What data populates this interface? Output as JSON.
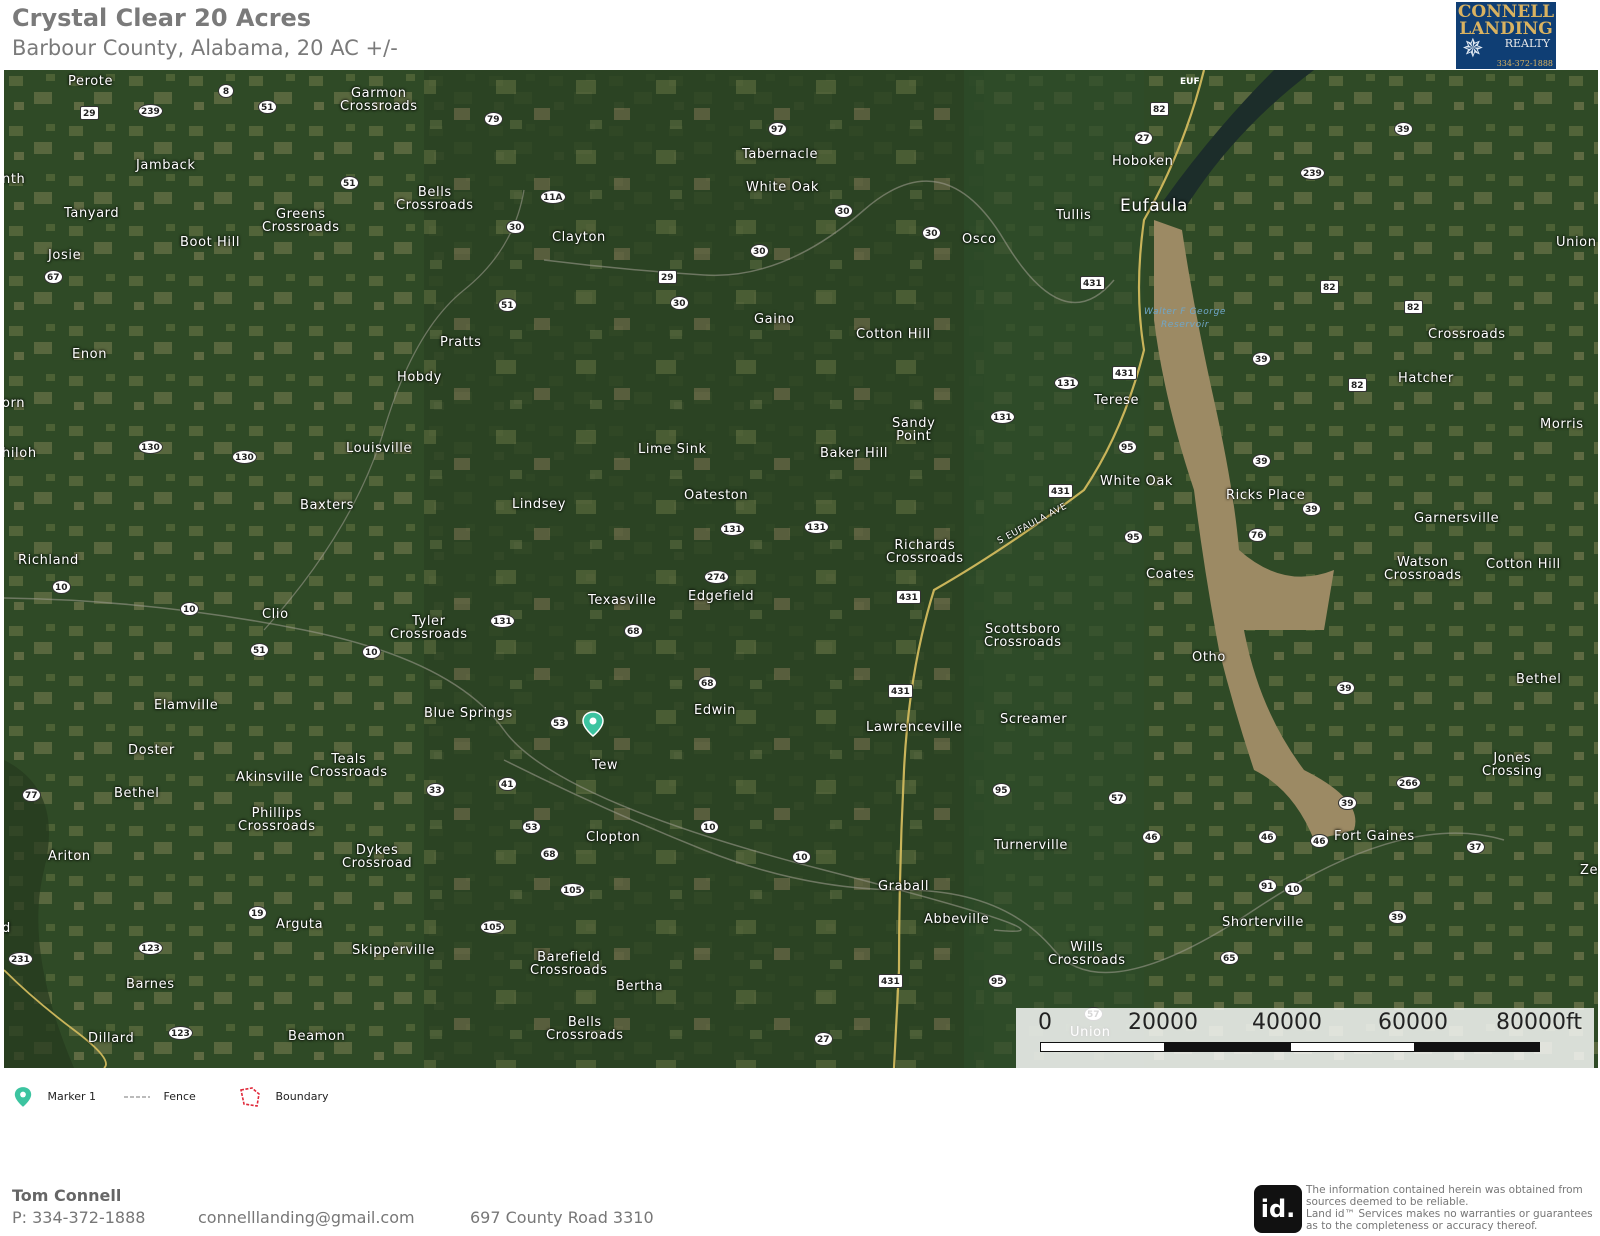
{
  "header": {
    "title": "Crystal Clear 20 Acres",
    "subtitle": "Barbour County, Alabama, 20 AC +/-"
  },
  "logo": {
    "line1": "CONNELL",
    "line2": "LANDING",
    "line3": "REALTY",
    "phone": "334-372-1888"
  },
  "map": {
    "places": [
      {
        "name": "Perote",
        "id": "perote"
      },
      {
        "name": "Garmon\nCrossroads",
        "id": "garmon"
      },
      {
        "name": "Jamback",
        "id": "jamback"
      },
      {
        "name": "Tabernacle",
        "id": "tabernacle"
      },
      {
        "name": "White Oak",
        "id": "white-oak-n"
      },
      {
        "name": "Hoboken",
        "id": "hoboken"
      },
      {
        "name": "Eufaula",
        "id": "eufaula"
      },
      {
        "name": "Tullis",
        "id": "tullis"
      },
      {
        "name": "Tanyard",
        "id": "tanyard"
      },
      {
        "name": "Greens\nCrossroads",
        "id": "greens"
      },
      {
        "name": "Bells\nCrossroads",
        "id": "bells-n"
      },
      {
        "name": "Clayton",
        "id": "clayton"
      },
      {
        "name": "Osco",
        "id": "osco"
      },
      {
        "name": "Union",
        "id": "union-e"
      },
      {
        "name": "Boot Hill",
        "id": "boot-hill"
      },
      {
        "name": "Josie",
        "id": "josie"
      },
      {
        "name": "Gaino",
        "id": "gaino"
      },
      {
        "name": "Cotton Hill",
        "id": "cotton-hill-n"
      },
      {
        "name": "Crossroads",
        "id": "crossroads-e"
      },
      {
        "name": "Enon",
        "id": "enon"
      },
      {
        "name": "Pratts",
        "id": "pratts"
      },
      {
        "name": "Hobdy",
        "id": "hobdy"
      },
      {
        "name": "Hatcher",
        "id": "hatcher"
      },
      {
        "name": "Terese",
        "id": "terese"
      },
      {
        "name": "Morris",
        "id": "morris"
      },
      {
        "name": "Sandy\nPoint",
        "id": "sandy-point"
      },
      {
        "name": "Louisville",
        "id": "louisville"
      },
      {
        "name": "Lime Sink",
        "id": "lime-sink"
      },
      {
        "name": "Baker Hill",
        "id": "baker-hill"
      },
      {
        "name": "White Oak",
        "id": "white-oak-s"
      },
      {
        "name": "Ricks Place",
        "id": "ricks-place"
      },
      {
        "name": "Oateston",
        "id": "oateston"
      },
      {
        "name": "Baxters",
        "id": "baxters"
      },
      {
        "name": "Lindsey",
        "id": "lindsey"
      },
      {
        "name": "Garnersville",
        "id": "garnersville"
      },
      {
        "name": "Richards\nCrossroads",
        "id": "richards"
      },
      {
        "name": "Richland",
        "id": "richland"
      },
      {
        "name": "Watson\nCrossroads",
        "id": "watson"
      },
      {
        "name": "Cotton Hill",
        "id": "cotton-hill-e"
      },
      {
        "name": "Coates",
        "id": "coates"
      },
      {
        "name": "Edgefield",
        "id": "edgefield"
      },
      {
        "name": "Texasville",
        "id": "texasville"
      },
      {
        "name": "Clio",
        "id": "clio"
      },
      {
        "name": "Tyler\nCrossroads",
        "id": "tyler"
      },
      {
        "name": "Scottsboro\nCrossroads",
        "id": "scottsboro"
      },
      {
        "name": "Otho",
        "id": "otho"
      },
      {
        "name": "Bethel",
        "id": "bethel-e"
      },
      {
        "name": "Elamville",
        "id": "elamville"
      },
      {
        "name": "Edwin",
        "id": "edwin"
      },
      {
        "name": "Blue Springs",
        "id": "blue-springs"
      },
      {
        "name": "Screamer",
        "id": "screamer"
      },
      {
        "name": "Lawrenceville",
        "id": "lawrenceville"
      },
      {
        "name": "Doster",
        "id": "doster"
      },
      {
        "name": "Teals\nCrossroads",
        "id": "teals"
      },
      {
        "name": "Tew",
        "id": "tew"
      },
      {
        "name": "Jones\nCrossing",
        "id": "jones"
      },
      {
        "name": "Akinsville",
        "id": "akinsville"
      },
      {
        "name": "Bethel",
        "id": "bethel-w"
      },
      {
        "name": "Phillips\nCrossroads",
        "id": "phillips"
      },
      {
        "name": "Clopton",
        "id": "clopton"
      },
      {
        "name": "Fort Gaines",
        "id": "fort-gaines"
      },
      {
        "name": "Turnerville",
        "id": "turnerville"
      },
      {
        "name": "Dykes\nCrossroad",
        "id": "dykes"
      },
      {
        "name": "Ariton",
        "id": "ariton"
      },
      {
        "name": "Zetto",
        "id": "zetto"
      },
      {
        "name": "Graball",
        "id": "graball"
      },
      {
        "name": "Abbeville",
        "id": "abbeville"
      },
      {
        "name": "Arguta",
        "id": "arguta"
      },
      {
        "name": "Shorterville",
        "id": "shorterville"
      },
      {
        "name": "Skipperville",
        "id": "skipperville"
      },
      {
        "name": "Barefield\nCrossroads",
        "id": "barefield"
      },
      {
        "name": "Wills\nCrossroads",
        "id": "wills"
      },
      {
        "name": "Barnes",
        "id": "barnes"
      },
      {
        "name": "Bertha",
        "id": "bertha"
      },
      {
        "name": "Bells\nCrossroads",
        "id": "bells-s"
      },
      {
        "name": "Dillard",
        "id": "dillard"
      },
      {
        "name": "Beamon",
        "id": "beamon"
      },
      {
        "name": "Union",
        "id": "union-s"
      },
      {
        "name": "nth",
        "id": "nth"
      },
      {
        "name": "orn",
        "id": "orn"
      },
      {
        "name": "hiloh",
        "id": "hiloh"
      },
      {
        "name": "d",
        "id": "d-edge"
      }
    ],
    "road_label": "S EUFAULA AVE",
    "lake_label": "Walter F George\nReservoir",
    "routes": [
      "8",
      "29",
      "239",
      "51",
      "79",
      "97",
      "82",
      "27",
      "39",
      "239",
      "51",
      "11A",
      "30",
      "30",
      "30",
      "30",
      "29",
      "67",
      "30",
      "431",
      "82",
      "82",
      "51",
      "131",
      "431",
      "82",
      "39",
      "130",
      "130",
      "131",
      "95",
      "131",
      "131",
      "431",
      "39",
      "39",
      "95",
      "76",
      "274",
      "10",
      "131",
      "68",
      "10",
      "431",
      "51",
      "10",
      "68",
      "39",
      "53",
      "431",
      "95",
      "57",
      "266",
      "33",
      "41",
      "77",
      "53",
      "68",
      "46",
      "46",
      "46",
      "39",
      "10",
      "10",
      "37",
      "105",
      "91",
      "10",
      "39",
      "19",
      "105",
      "123",
      "65",
      "231",
      "95",
      "431",
      "123",
      "27",
      "57",
      "EUF"
    ]
  },
  "scale": {
    "labels": [
      "0",
      "20000",
      "40000",
      "60000",
      "80000ft"
    ]
  },
  "legend": {
    "items": [
      {
        "label": "Marker 1",
        "icon": "map-pin-icon",
        "color": "#3cc4a0"
      },
      {
        "label": "Fence",
        "icon": "fence-icon",
        "color": "#cccccc"
      },
      {
        "label": "Boundary",
        "icon": "boundary-icon",
        "color": "#e0283a"
      }
    ]
  },
  "footer": {
    "name": "Tom  Connell",
    "phone": "P: 334-372-1888",
    "email": "connelllanding@gmail.com",
    "address": "697 County Road 3310",
    "id_logo": "id.",
    "disclaimer": "The information contained herein was obtained from sources deemed to be reliable.\n  Land id™ Services makes no warranties or guarantees as to the completeness or accuracy thereof."
  },
  "colors": {
    "marker": "#3cc4a0",
    "boundary": "#e0283a",
    "water": "#9c8a64",
    "forest": "#2c4324"
  }
}
